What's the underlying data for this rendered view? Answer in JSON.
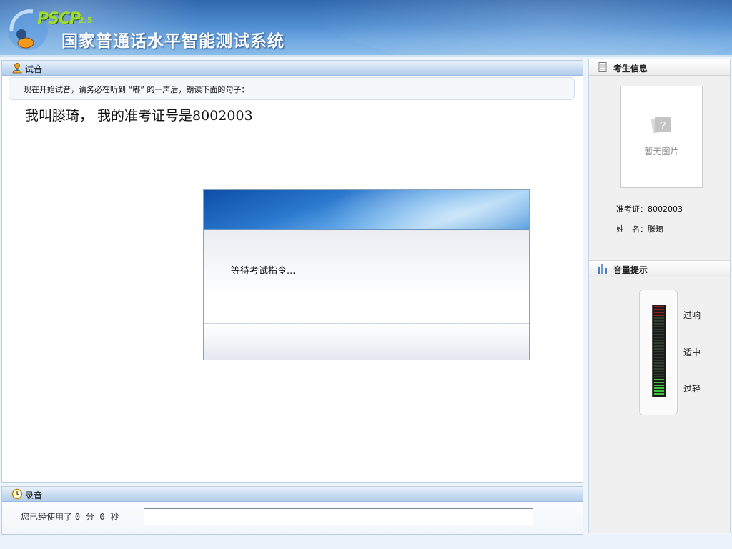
{
  "header": {
    "logo_text": "PSCP",
    "logo_version": "2.5",
    "title": "国家普通话水平智能测试系统"
  },
  "main": {
    "section_title": "试音",
    "instruction": "现在开始试音，请务必在听到 “嘟” 的一声后，朗读下面的句子：",
    "reading_text": "我叫滕琦， 我的准考证号是8002003"
  },
  "dialog": {
    "message": "等待考试指令..."
  },
  "recording": {
    "section_title": "录音",
    "prefix": "您已经使用了",
    "minutes": "0",
    "minutes_unit": "分",
    "seconds": "0",
    "seconds_unit": "秒",
    "progress": 0
  },
  "candidate": {
    "section_title": "考生信息",
    "photo_placeholder": "暂无图片",
    "ticket_label": "准考证：",
    "ticket_value": "8002003",
    "name_label": "姓　名：",
    "name_value": "滕琦"
  },
  "volume": {
    "section_title": "音量提示",
    "levels": [
      "过响",
      "适中",
      "过轻"
    ],
    "current_level": 0.2
  },
  "colors": {
    "header_blue": "#2f67ad",
    "logo_green": "#9fdc2c",
    "meter_green": "#39c43b",
    "meter_red": "#a01818"
  },
  "icons": {
    "trial": "user-mic-icon",
    "record": "clock-icon",
    "candidate": "document-icon",
    "volume": "volume-bars-icon",
    "photo": "image-placeholder-icon"
  }
}
